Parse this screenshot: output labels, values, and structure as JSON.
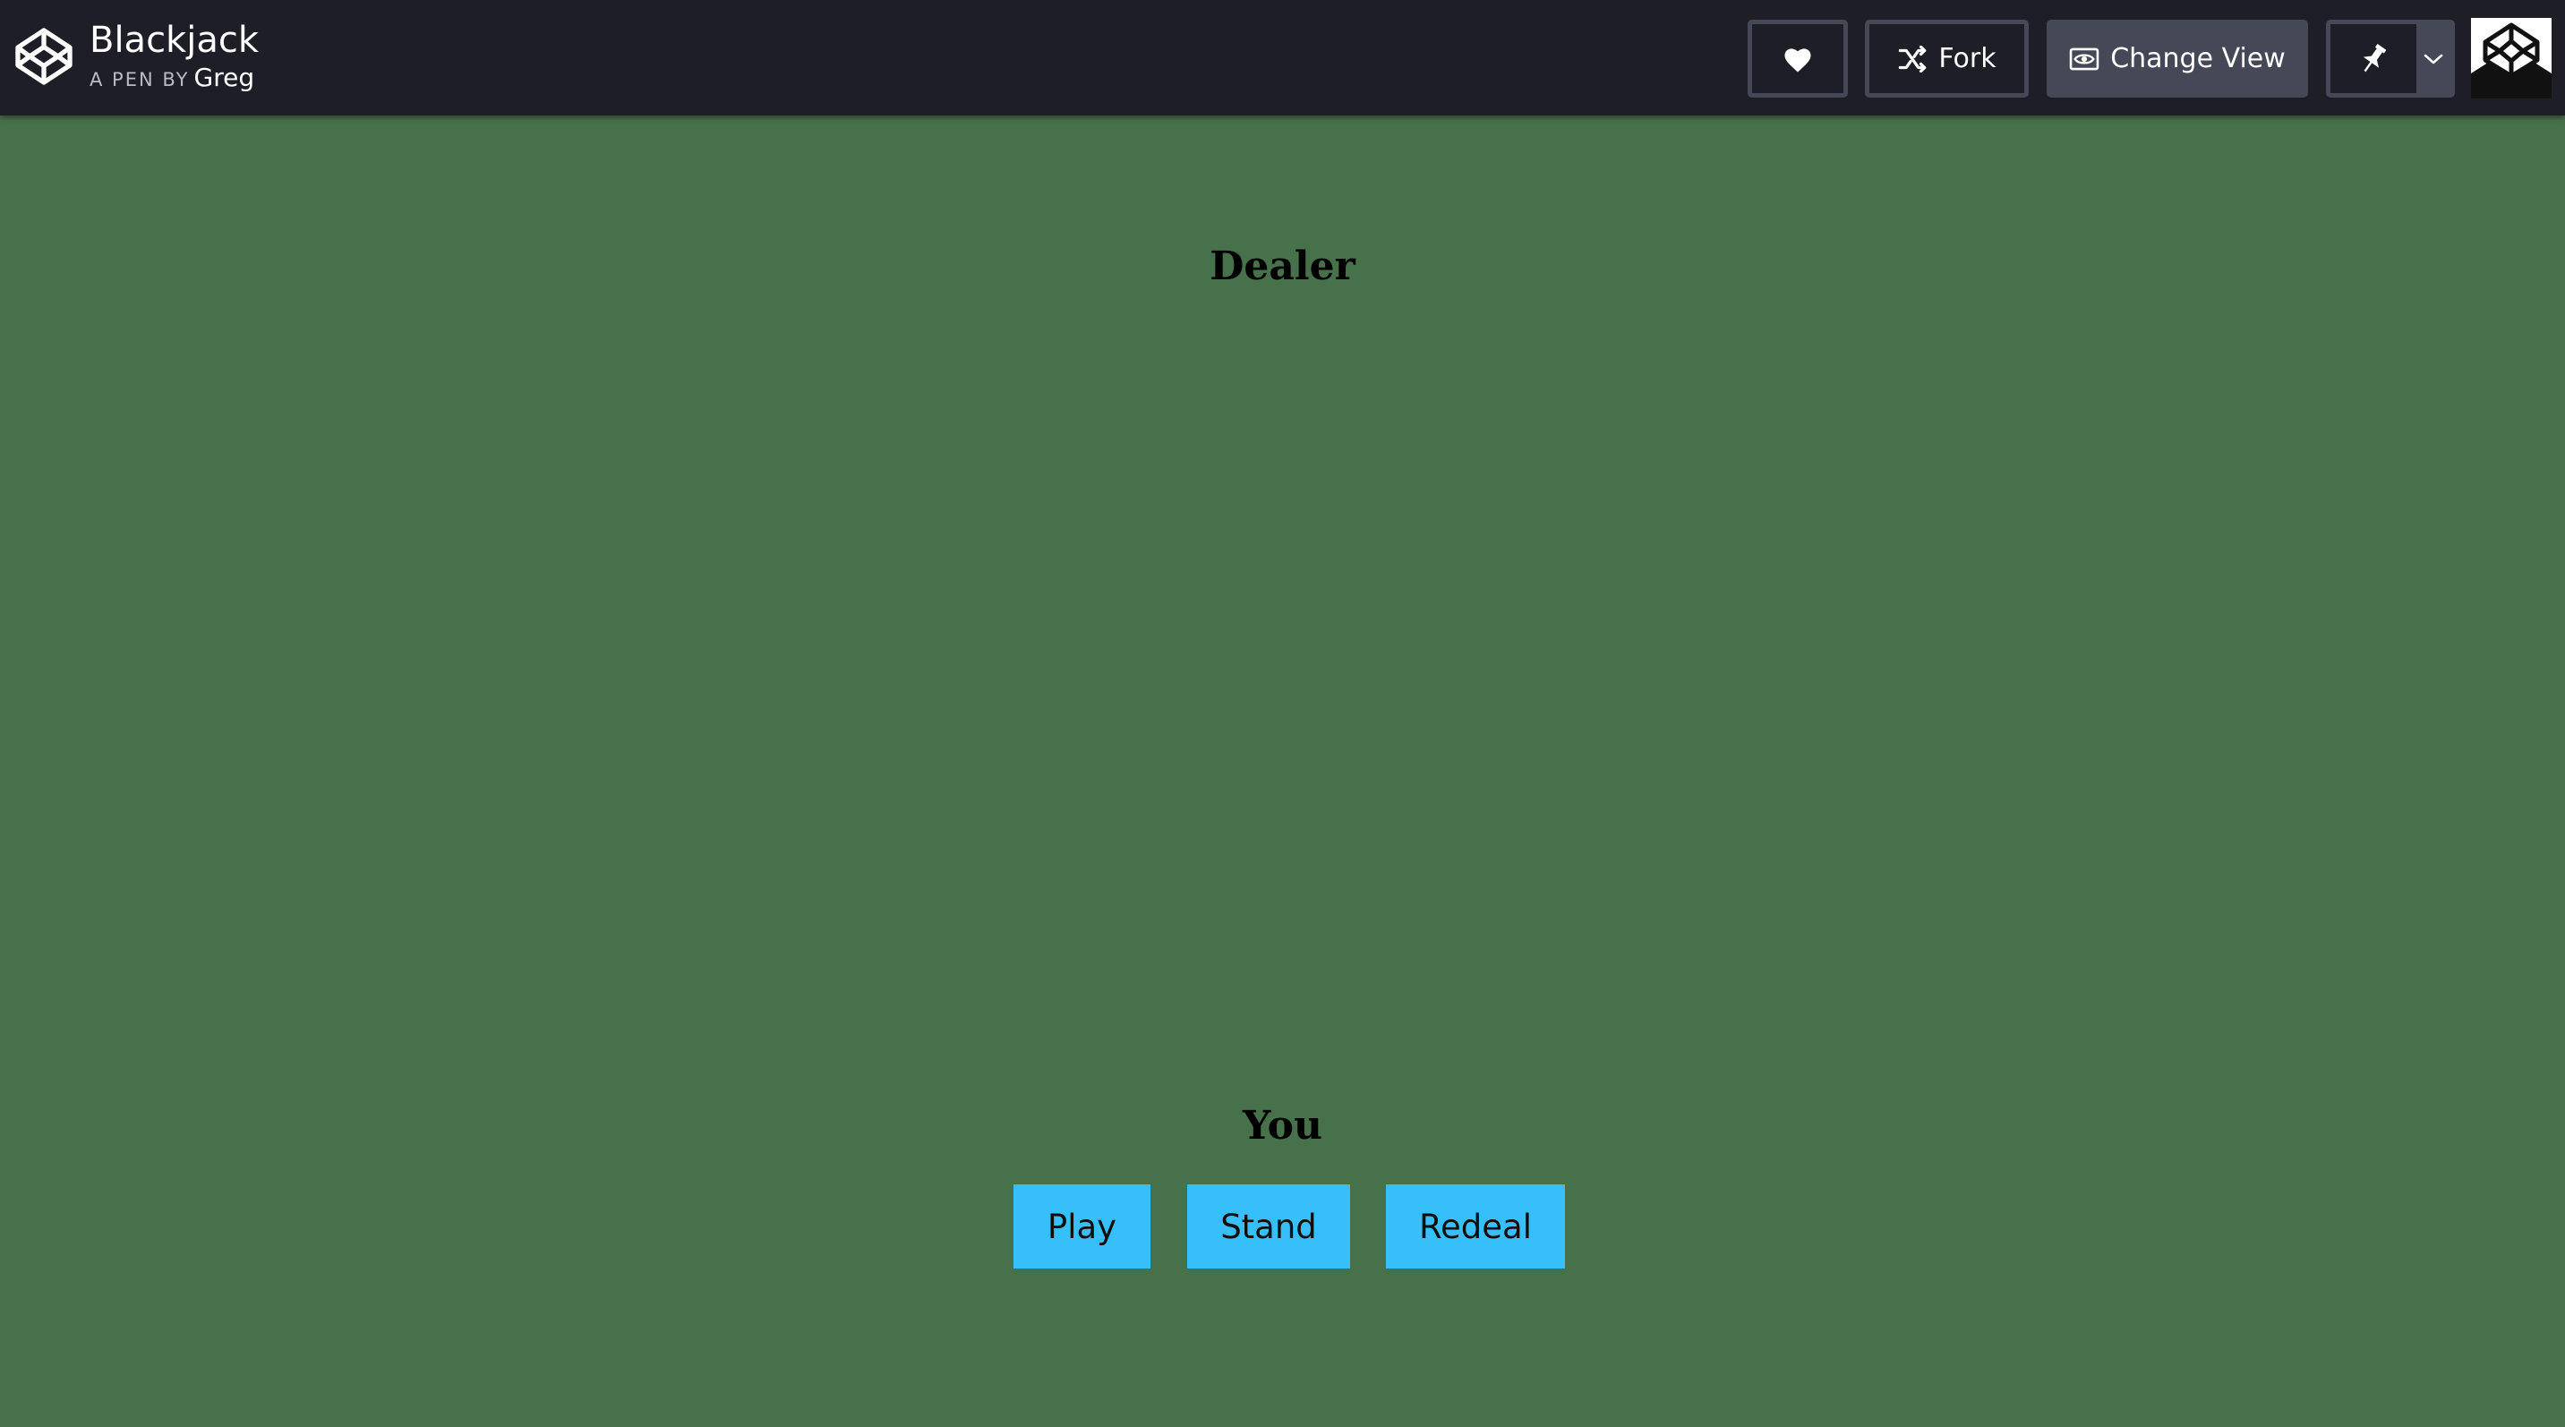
{
  "header": {
    "title": "Blackjack",
    "byline_prefix": "A PEN BY",
    "author": "Greg",
    "fork_label": "Fork",
    "change_view_label": "Change View"
  },
  "icons": {
    "logo": "codepen-logo-icon",
    "heart": "heart-icon",
    "fork": "fork-icon",
    "change_view": "eye-icon",
    "pin": "pin-icon",
    "dropdown": "chevron-down-icon",
    "avatar": "user-avatar"
  },
  "game": {
    "dealer_heading": "Dealer",
    "player_heading": "You",
    "buttons": {
      "play": "Play",
      "stand": "Stand",
      "redeal": "Redeal"
    }
  },
  "colors": {
    "table_green": "#46714a",
    "header_bg": "#1e1f26",
    "button_blue": "#37bff9",
    "header_button_border": "#444857"
  }
}
